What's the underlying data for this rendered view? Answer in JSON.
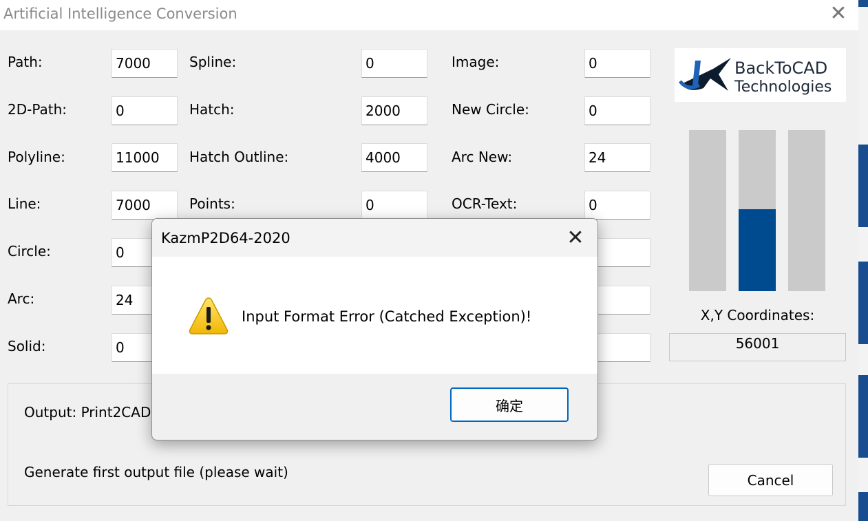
{
  "window": {
    "title": "Artificial Intelligence Conversion",
    "close_glyph": "✕"
  },
  "fields": [
    {
      "label": "Path:",
      "value": "7000"
    },
    {
      "label": "2D-Path:",
      "value": "0"
    },
    {
      "label": "Polyline:",
      "value": "11000"
    },
    {
      "label": "Line:",
      "value": "7000"
    },
    {
      "label": "Circle:",
      "value": "0"
    },
    {
      "label": "Arc:",
      "value": "24"
    },
    {
      "label": "Solid:",
      "value": "0"
    },
    {
      "label": "Spline:",
      "value": "0"
    },
    {
      "label": "Hatch:",
      "value": "2000"
    },
    {
      "label": "Hatch Outline:",
      "value": "4000"
    },
    {
      "label": "Points:",
      "value": "0"
    },
    {
      "label": "Image:",
      "value": "0"
    },
    {
      "label": "New Circle:",
      "value": "0"
    },
    {
      "label": "Arc New:",
      "value": "24"
    },
    {
      "label": "OCR-Text:",
      "value": "0"
    }
  ],
  "logo": {
    "line1": "BackToCAD",
    "line2": "Technologies"
  },
  "progress_bars": [
    {
      "level": 0.0
    },
    {
      "level": 0.51
    },
    {
      "level": 0.0
    }
  ],
  "coordinates": {
    "label": "X,Y Coordinates:",
    "value": "56001"
  },
  "status": {
    "output": "Output: Print2CAD-",
    "generate": "Generate first output file (please wait)"
  },
  "cancel_label": "Cancel",
  "dialog": {
    "title": "KazmP2D64-2020",
    "close_glyph": "✕",
    "message": "Input Format Error (Catched Exception)!",
    "ok_label": "确定",
    "icon": "warning-icon"
  },
  "colors": {
    "accent": "#004a8f",
    "button_focus": "#0067c0",
    "warning": "#f5c518"
  }
}
